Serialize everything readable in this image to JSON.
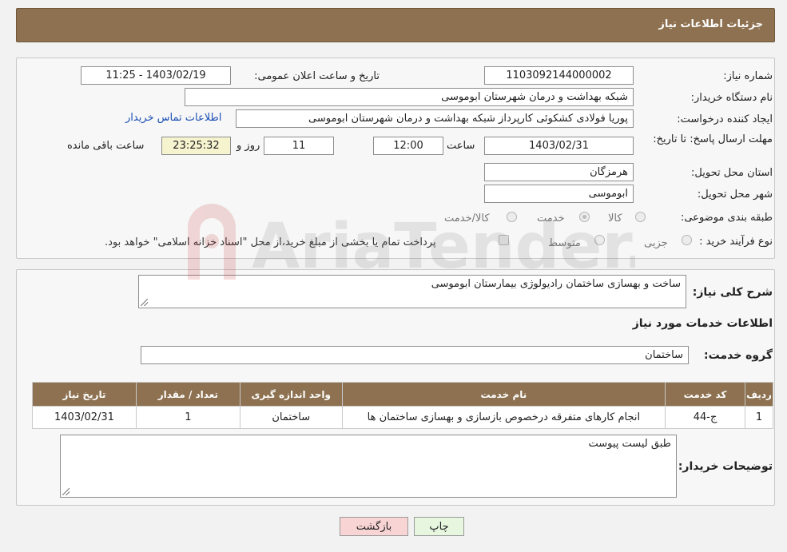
{
  "header": {
    "title": "جزئیات اطلاعات نیاز"
  },
  "fields": {
    "need_number_label": "شماره نیاز:",
    "need_number": "1103092144000002",
    "announce_label": "تاریخ و ساعت اعلان عمومی:",
    "announce_value": "1403/02/19 - 11:25",
    "buyer_org_label": "نام دستگاه خریدار:",
    "buyer_org": "شبکه بهداشت و درمان شهرستان ابوموسی",
    "creator_label": "ایجاد کننده درخواست:",
    "creator": "پوریا فولادی کشکوئی کارپرداز شبکه بهداشت و درمان شهرستان ابوموسی",
    "contact_link": "اطلاعات تماس خریدار",
    "deadline_label": "مهلت ارسال پاسخ: تا تاریخ:",
    "deadline_date": "1403/02/31",
    "time_label": "ساعت",
    "deadline_time": "12:00",
    "days_value": "11",
    "days_label": "روز و",
    "remaining_time": "23:25:32",
    "remaining_label": "ساعت باقی مانده",
    "province_label": "استان محل تحویل:",
    "province": "هرمزگان",
    "city_label": "شهر محل تحویل:",
    "city": "ابوموسی",
    "category_label": "طبقه بندی موضوعی:",
    "category_options": [
      "کالا",
      "خدمت",
      "کالا/خدمت"
    ],
    "category_selected": "خدمت",
    "process_label": "نوع فرآیند خرید :",
    "process_options": [
      "جزیی",
      "متوسط"
    ],
    "payment_note": "پرداخت تمام یا بخشی از مبلغ خرید،از محل \"اسناد خزانه اسلامی\" خواهد بود."
  },
  "description": {
    "label": "شرح کلی نیاز:",
    "value": "ساخت و بهسازی ساختمان رادیولوژی بیمارستان ابوموسی"
  },
  "services": {
    "section_title": "اطلاعات خدمات مورد نیاز",
    "group_label": "گروه خدمت:",
    "group_value": "ساختمان",
    "table": {
      "headers": [
        "ردیف",
        "کد خدمت",
        "نام خدمت",
        "واحد اندازه گیری",
        "تعداد / مقدار",
        "تاریخ نیاز"
      ],
      "rows": [
        [
          "1",
          "ج-44",
          "انجام کارهای متفرقه درخصوص بازسازی و بهسازی ساختمان ها",
          "ساختمان",
          "1",
          "1403/02/31"
        ]
      ]
    }
  },
  "buyer_notes": {
    "label": "توضیحات خریدار:",
    "value": "طبق لیست پیوست"
  },
  "buttons": {
    "print": "چاپ",
    "back": "بازگشت"
  },
  "watermark": {
    "text": "AriaTender.neT"
  },
  "colors": {
    "header_bg": "#8d7150",
    "link": "#1a4fb5",
    "back_btn": "#f9d4d4",
    "print_btn": "#e7f7df"
  }
}
